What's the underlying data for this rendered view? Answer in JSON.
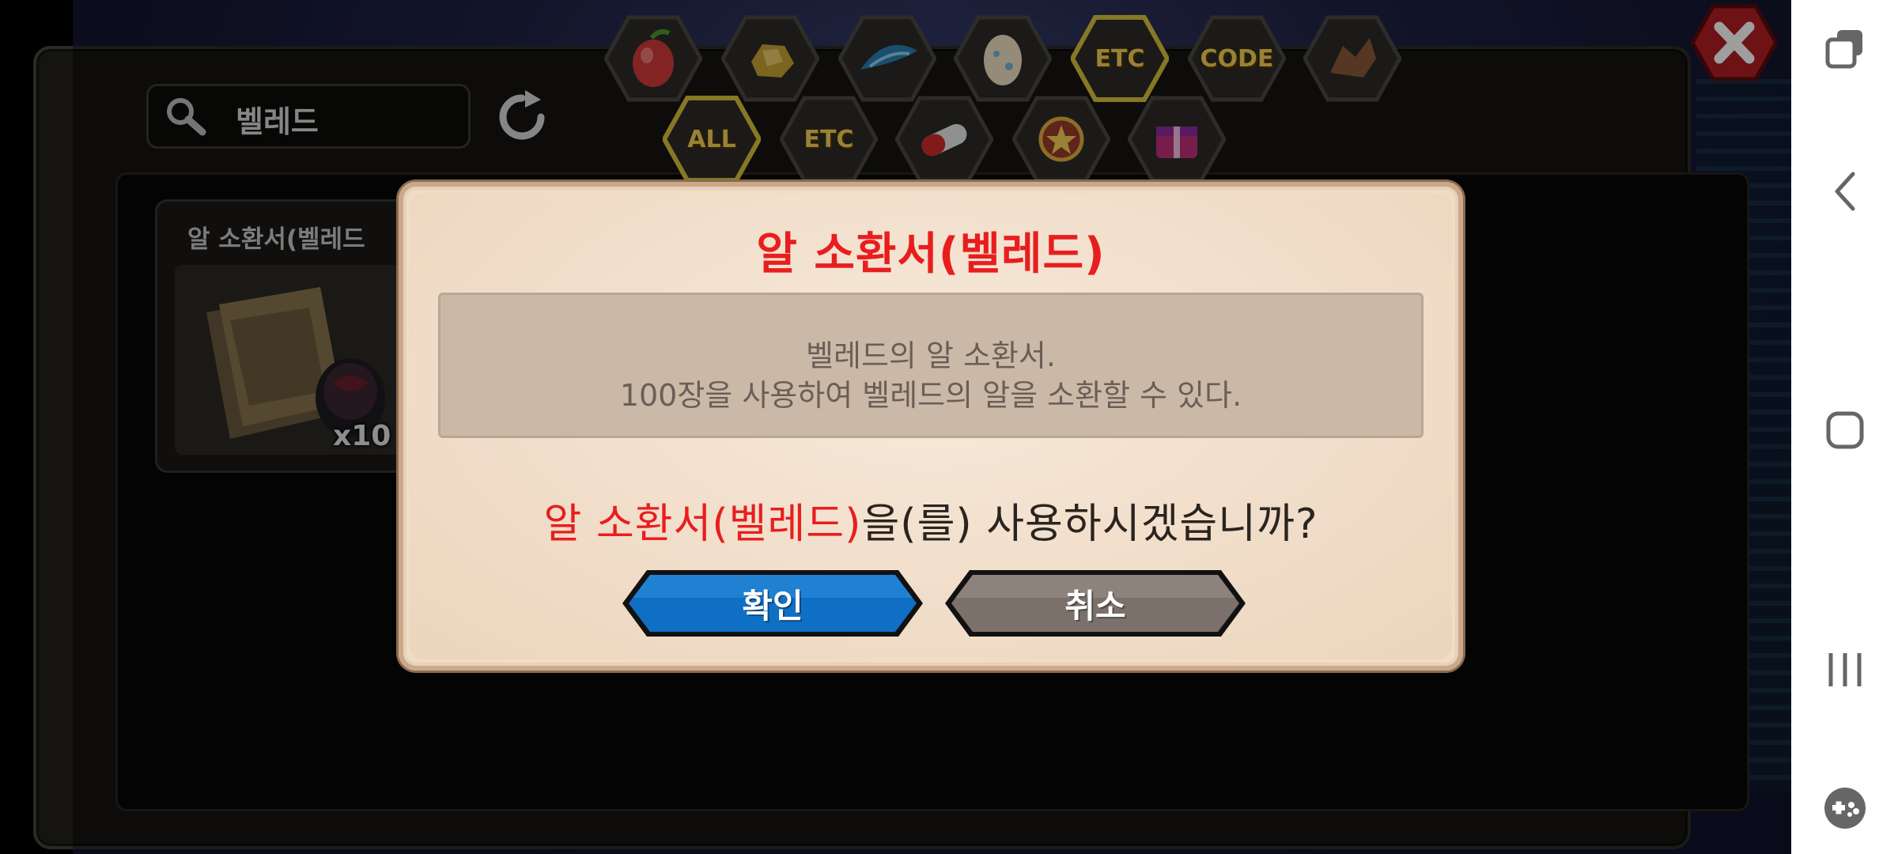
{
  "search": {
    "value": "벨레드"
  },
  "category_tabs": {
    "row1": [
      {
        "name": "fruit-tab-icon"
      },
      {
        "name": "gold-ore-tab-icon"
      },
      {
        "name": "blue-feather-tab-icon"
      },
      {
        "name": "egg-tab-icon"
      },
      {
        "name": "etc-tab",
        "label": "ETC",
        "selected": true
      },
      {
        "name": "code-tab",
        "label": "CODE"
      },
      {
        "name": "dragon-tab-icon"
      }
    ],
    "row2": [
      {
        "name": "all-tab",
        "label": "ALL",
        "selected": true
      },
      {
        "name": "etc-subtab",
        "label": "ETC"
      },
      {
        "name": "capsule-tab-icon"
      },
      {
        "name": "medal-tab-icon"
      },
      {
        "name": "gift-box-tab-icon"
      }
    ]
  },
  "item": {
    "name": "알 소환서(벨레드",
    "count": "x10"
  },
  "dialog": {
    "title": "알 소환서(벨레드)",
    "description": [
      "벨레드의 알 소환서.",
      "100장을 사용하여 벨레드의 알을 소환할 수 있다."
    ],
    "question_item": "알 소환서(벨레드)",
    "question_rest": "을(를) 사용하시겠습니까?",
    "confirm_label": "확인",
    "cancel_label": "취소"
  },
  "colors": {
    "title_red": "#e81e1e",
    "confirm_blue": "#0f6fc4",
    "cancel_gray": "#7c706a",
    "tab_gold": "#f4d256"
  },
  "navbar": [
    "recent-apps-icon",
    "back-icon",
    "home-icon",
    "menu-icon",
    "game-launcher-icon"
  ]
}
